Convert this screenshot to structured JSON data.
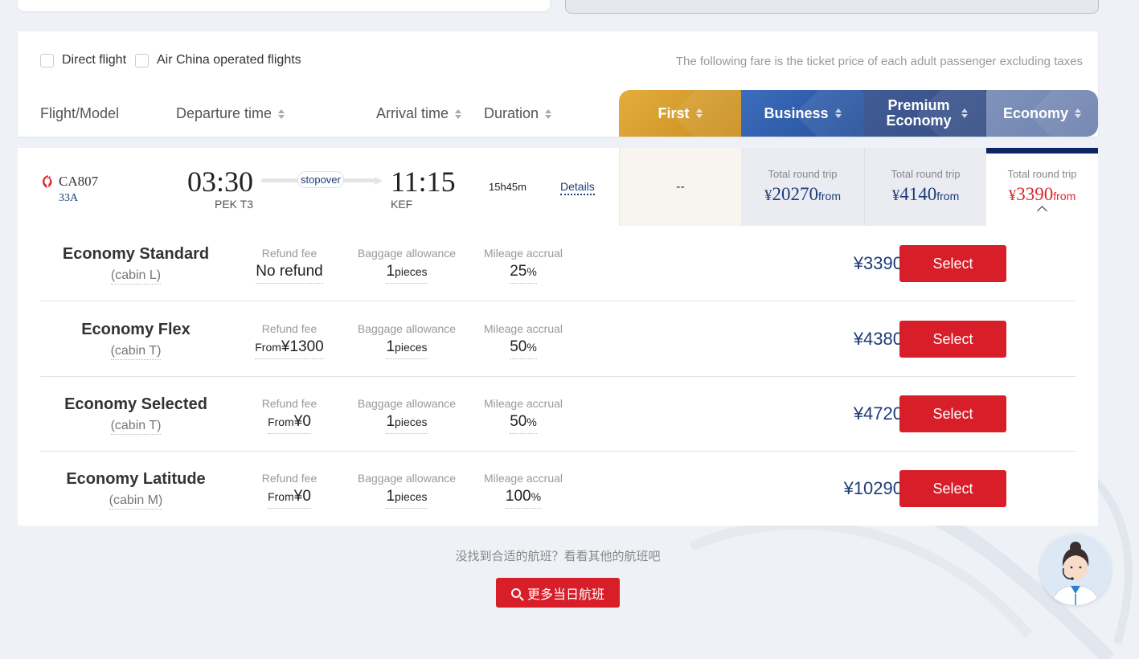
{
  "filters": {
    "direct_flight": "Direct flight",
    "air_china_operated": "Air China operated flights",
    "fare_note": "The following fare is the ticket price of each adult passenger excluding taxes"
  },
  "columns": {
    "flight_model": "Flight/Model",
    "departure_time": "Departure time",
    "arrival_time": "Arrival time",
    "duration": "Duration"
  },
  "cabin_tabs": {
    "first": "First",
    "business": "Business",
    "premium_economy": "Premium Economy",
    "economy": "Economy"
  },
  "flight": {
    "number": "CA807",
    "model": "33A",
    "departure_time": "03:30",
    "departure_airport": "PEK T3",
    "stop": "stopover",
    "arrival_time": "11:15",
    "arrival_airport": "KEF",
    "duration": "15h45m",
    "details": "Details"
  },
  "class_prices": {
    "first": {
      "value": "--"
    },
    "business": {
      "label": "Total round trip",
      "currency": "¥",
      "amount": "20270",
      "suffix": "from"
    },
    "premium_economy": {
      "label": "Total round trip",
      "currency": "¥",
      "amount": "4140",
      "suffix": "from"
    },
    "economy": {
      "label": "Total round trip",
      "currency": "¥",
      "amount": "3390",
      "suffix": "from"
    }
  },
  "fare_labels": {
    "refund": "Refund fee",
    "baggage": "Baggage allowance",
    "mileage": "Mileage accrual",
    "select": "Select"
  },
  "fares": [
    {
      "name": "Economy Standard",
      "cabin": "(cabin L)",
      "refund_prefix": "",
      "refund_value": "No refund",
      "baggage_num": "1",
      "baggage_unit": "pieces",
      "mileage_num": "25",
      "mileage_unit": "%",
      "price": "¥3390"
    },
    {
      "name": "Economy Flex",
      "cabin": "(cabin T)",
      "refund_prefix": "From",
      "refund_value": "¥1300",
      "baggage_num": "1",
      "baggage_unit": "pieces",
      "mileage_num": "50",
      "mileage_unit": "%",
      "price": "¥4380"
    },
    {
      "name": "Economy Selected",
      "cabin": "(cabin T)",
      "refund_prefix": "From",
      "refund_value": "¥0",
      "baggage_num": "1",
      "baggage_unit": "pieces",
      "mileage_num": "50",
      "mileage_unit": "%",
      "price": "¥4720"
    },
    {
      "name": "Economy Latitude",
      "cabin": "(cabin M)",
      "refund_prefix": "From",
      "refund_value": "¥0",
      "baggage_num": "1",
      "baggage_unit": "pieces",
      "mileage_num": "100",
      "mileage_unit": "%",
      "price": "¥10290"
    }
  ],
  "footer": {
    "not_found": "没找到合适的航班？看看其他的航班吧",
    "more_flights": "更多当日航班"
  },
  "colors": {
    "brand_red": "#d81e28",
    "navy": "#1e3c78",
    "first_gold": "#d79f2f",
    "business_blue": "#3260ad",
    "premium_blue": "#3a548c",
    "economy_blue": "#7587b3"
  },
  "icons": {
    "logo": "air-china-phoenix-logo",
    "search": "search-icon",
    "assistant": "customer-service-avatar"
  }
}
